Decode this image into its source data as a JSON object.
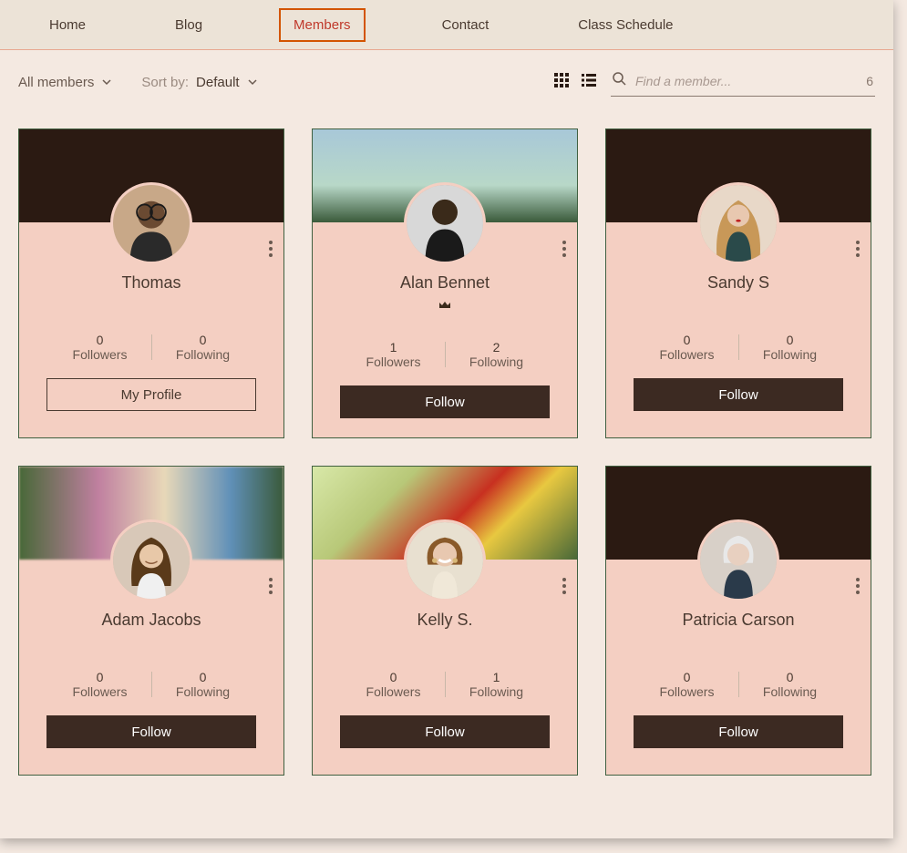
{
  "nav": {
    "items": [
      {
        "label": "Home",
        "active": false
      },
      {
        "label": "Blog",
        "active": false
      },
      {
        "label": "Members",
        "active": true
      },
      {
        "label": "Contact",
        "active": false
      },
      {
        "label": "Class Schedule",
        "active": false
      }
    ]
  },
  "toolbar": {
    "filter_label": "All members",
    "sort_prefix": "Sort by:",
    "sort_value": "Default",
    "search_placeholder": "Find a member...",
    "result_count": "6"
  },
  "members": [
    {
      "name": "Thomas",
      "followers_count": "0",
      "followers_label": "Followers",
      "following_count": "0",
      "following_label": "Following",
      "action_label": "My Profile",
      "action_style": "outline",
      "admin": false,
      "cover": "dark",
      "avatar_key": "thomas"
    },
    {
      "name": "Alan Bennet",
      "followers_count": "1",
      "followers_label": "Followers",
      "following_count": "2",
      "following_label": "Following",
      "action_label": "Follow",
      "action_style": "solid",
      "admin": true,
      "cover": "nature",
      "avatar_key": "alan"
    },
    {
      "name": "Sandy S",
      "followers_count": "0",
      "followers_label": "Followers",
      "following_count": "0",
      "following_label": "Following",
      "action_label": "Follow",
      "action_style": "solid",
      "admin": false,
      "cover": "dark",
      "avatar_key": "sandy"
    },
    {
      "name": "Adam Jacobs",
      "followers_count": "0",
      "followers_label": "Followers",
      "following_count": "0",
      "following_label": "Following",
      "action_label": "Follow",
      "action_style": "solid",
      "admin": false,
      "cover": "mats",
      "avatar_key": "adam"
    },
    {
      "name": "Kelly S.",
      "followers_count": "0",
      "followers_label": "Followers",
      "following_count": "1",
      "following_label": "Following",
      "action_label": "Follow",
      "action_style": "solid",
      "admin": false,
      "cover": "berry",
      "avatar_key": "kelly"
    },
    {
      "name": "Patricia Carson",
      "followers_count": "0",
      "followers_label": "Followers",
      "following_count": "0",
      "following_label": "Following",
      "action_label": "Follow",
      "action_style": "solid",
      "admin": false,
      "cover": "dark",
      "avatar_key": "patricia"
    }
  ],
  "colors": {
    "active_nav_border": "#d35400",
    "active_nav_text": "#c0392b",
    "card_bg": "#f4cfc2",
    "follow_btn_bg": "#3c2a22"
  }
}
